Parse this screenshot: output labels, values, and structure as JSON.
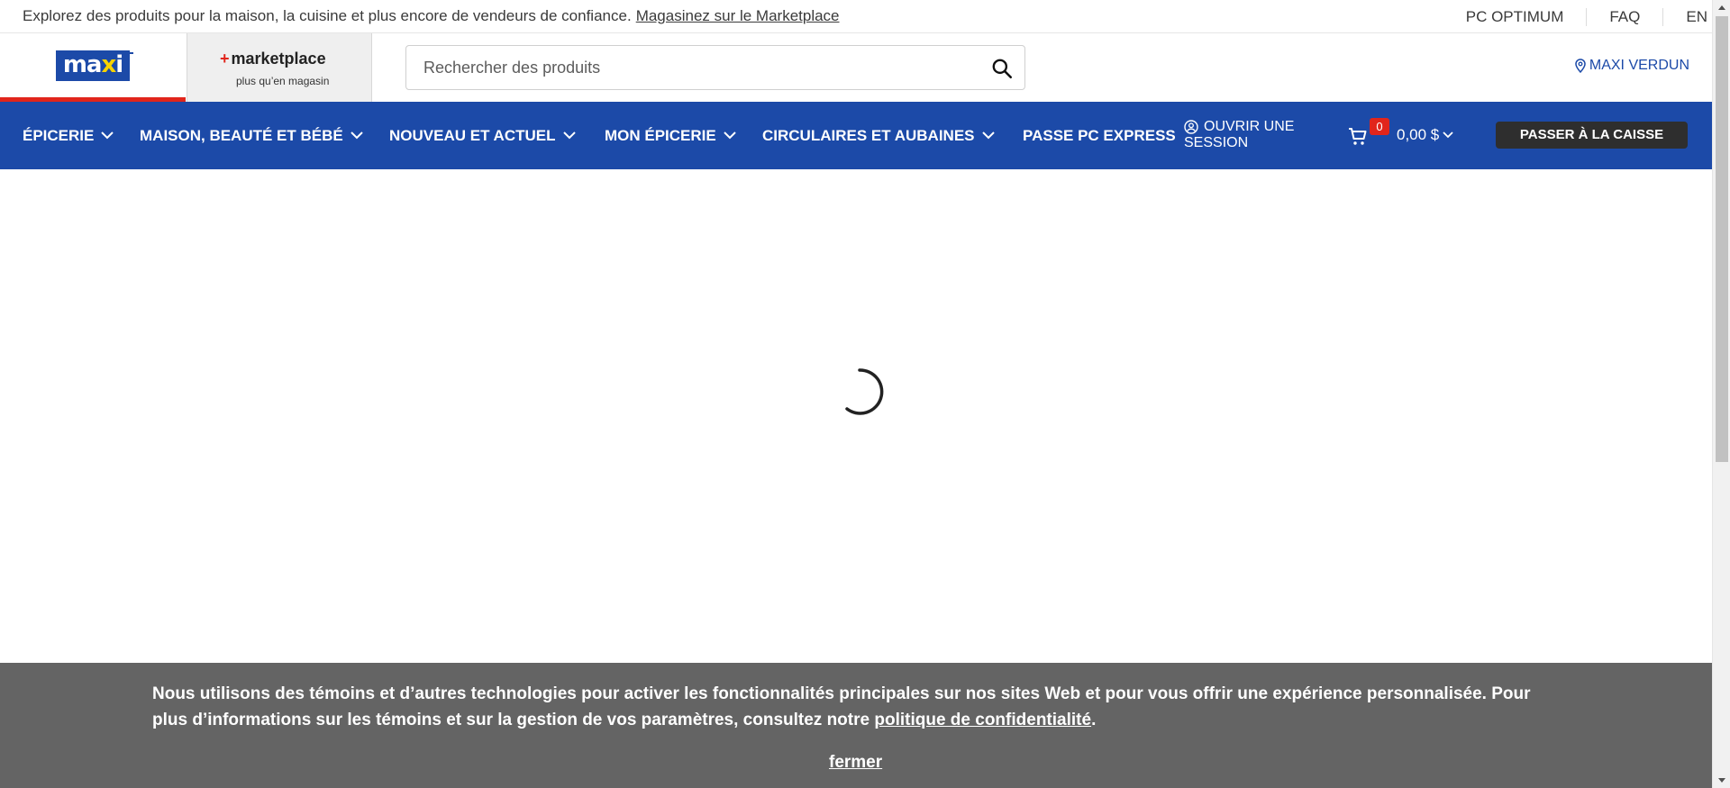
{
  "topbar": {
    "promo_text": "Explorez des produits pour la maison, la cuisine et plus encore de vendeurs de confiance.",
    "promo_link": "Magasinez sur le Marketplace",
    "links": [
      "PC OPTIMUM",
      "FAQ",
      "EN"
    ]
  },
  "header": {
    "logo_text_part1": "ma",
    "logo_text_part2": "x",
    "logo_text_part3": "i",
    "marketplace_title": "marketplace",
    "marketplace_sub": "plus qu’en magasin",
    "search_placeholder": "Rechercher des produits",
    "store_name": "MAXI VERDUN"
  },
  "nav": {
    "items": [
      "ÉPICERIE",
      "MAISON, BEAUTÉ ET BÉBÉ",
      "NOUVEAU ET ACTUEL",
      "MON ÉPICERIE",
      "CIRCULAIRES ET AUBAINES",
      "PASSE PC EXPRESS"
    ],
    "signin_line1": "OUVRIR UNE",
    "signin_line2": "SESSION",
    "cart_count": "0",
    "cart_total": "0,00 $",
    "checkout_label": "PASSER À LA CAISSE"
  },
  "cookie": {
    "text_before": "Nous utilisons des témoins et d’autres technologies pour activer les fonctionnalités principales sur nos sites Web et pour vous offrir une expérience personnalisée. Pour plus d’informations sur les témoins et sur la gestion de vos paramètres, consultez notre",
    "link": "politique de confidentialité",
    "text_after": ".",
    "close_label": "fermer"
  },
  "colors": {
    "brand_blue": "#1c4aa8",
    "brand_red": "#e1251b",
    "cookie_bg": "#646464",
    "checkout_bg": "#2e2e2e"
  }
}
